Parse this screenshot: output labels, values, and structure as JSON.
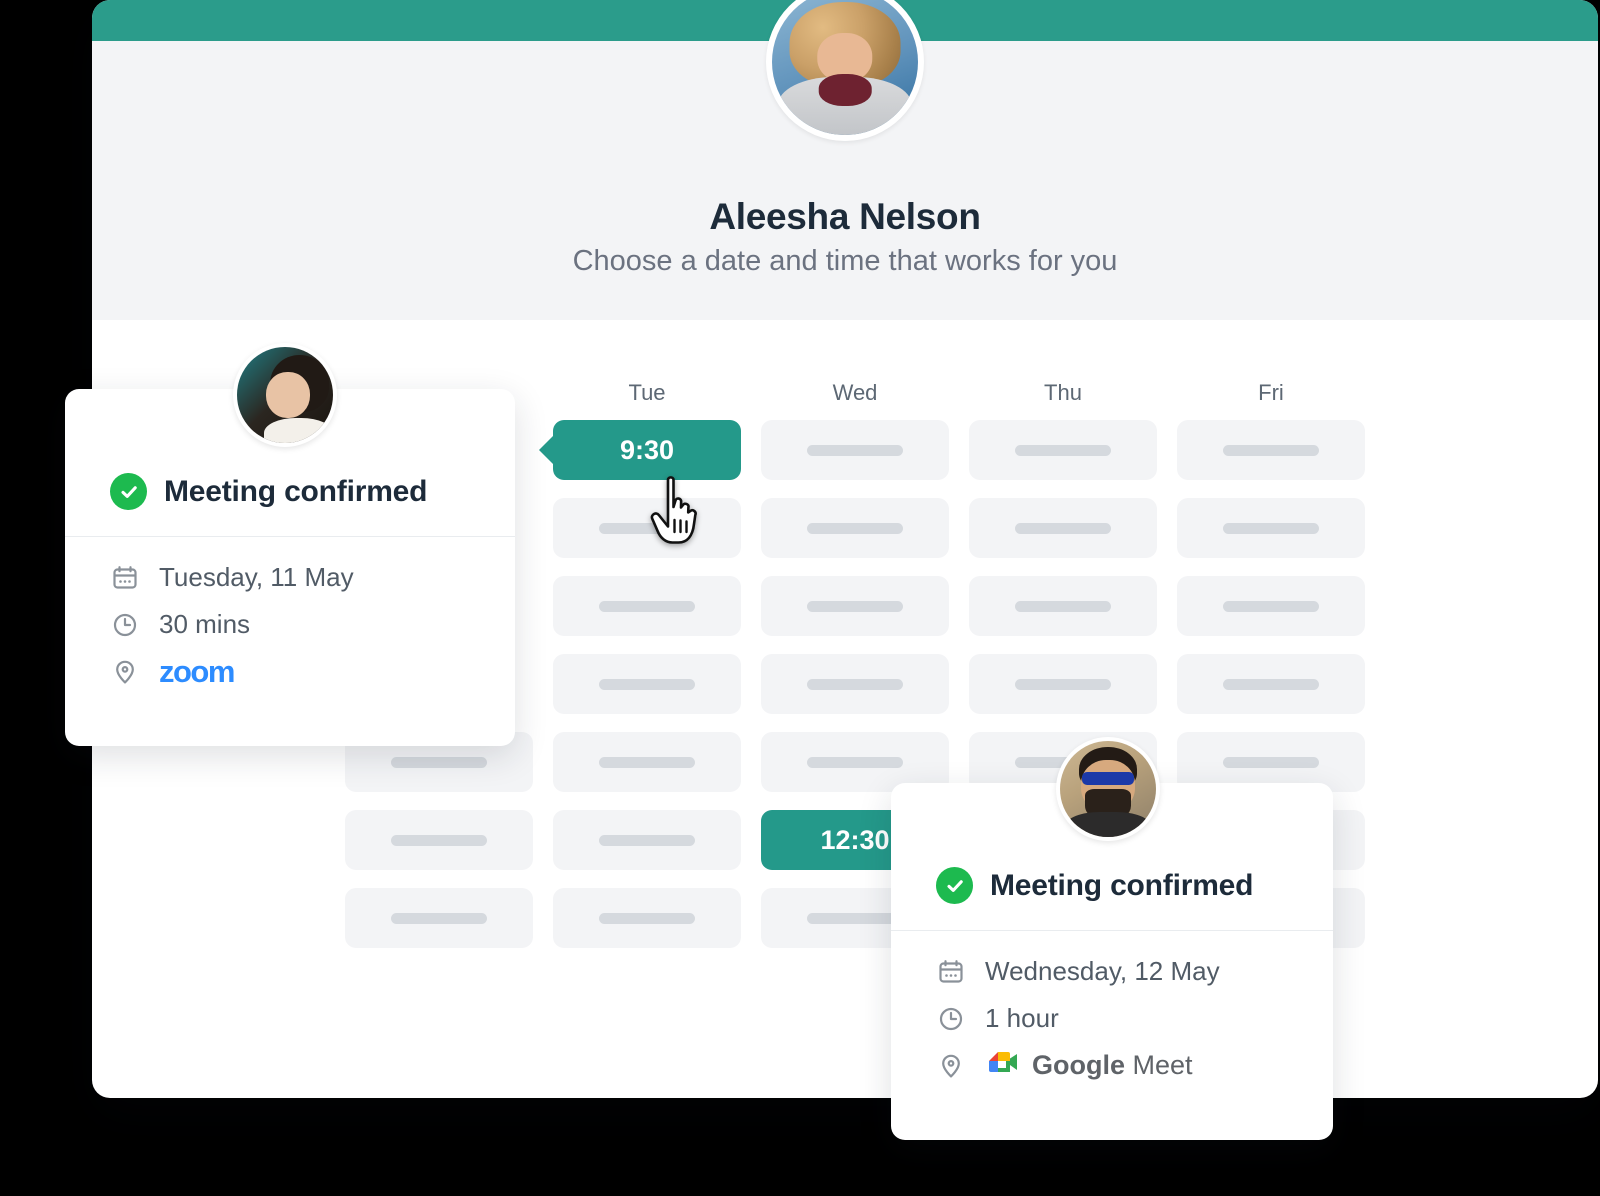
{
  "window": {
    "brand_color": "#2b9c8b",
    "header_bg": "#f3f4f6"
  },
  "header": {
    "avatar_name": "host-avatar",
    "host_name": "Aleesha Nelson",
    "subtitle": "Choose a date and time that works for you"
  },
  "calendar": {
    "day_headers": [
      "",
      "Tue",
      "Wed",
      "Thu",
      "Fri"
    ],
    "selected_color": "#24998a",
    "rows": [
      [
        {
          "state": "hidden",
          "label": ""
        },
        {
          "state": "selected",
          "label": "9:30",
          "notch": "left"
        },
        {
          "state": "empty",
          "label": ""
        },
        {
          "state": "empty",
          "label": ""
        },
        {
          "state": "empty",
          "label": ""
        }
      ],
      [
        {
          "state": "hidden",
          "label": ""
        },
        {
          "state": "empty",
          "label": ""
        },
        {
          "state": "empty",
          "label": ""
        },
        {
          "state": "empty",
          "label": ""
        },
        {
          "state": "empty",
          "label": ""
        }
      ],
      [
        {
          "state": "hidden",
          "label": ""
        },
        {
          "state": "empty",
          "label": ""
        },
        {
          "state": "empty",
          "label": ""
        },
        {
          "state": "empty",
          "label": ""
        },
        {
          "state": "empty",
          "label": ""
        }
      ],
      [
        {
          "state": "hidden",
          "label": ""
        },
        {
          "state": "empty",
          "label": ""
        },
        {
          "state": "empty",
          "label": ""
        },
        {
          "state": "empty",
          "label": ""
        },
        {
          "state": "empty",
          "label": ""
        }
      ],
      [
        {
          "state": "empty",
          "label": ""
        },
        {
          "state": "empty",
          "label": ""
        },
        {
          "state": "empty",
          "label": ""
        },
        {
          "state": "empty",
          "label": ""
        },
        {
          "state": "empty",
          "label": ""
        }
      ],
      [
        {
          "state": "empty",
          "label": ""
        },
        {
          "state": "empty",
          "label": ""
        },
        {
          "state": "selected",
          "label": "12:30",
          "notch": "right"
        },
        {
          "state": "empty",
          "label": ""
        },
        {
          "state": "empty",
          "label": ""
        }
      ],
      [
        {
          "state": "empty",
          "label": ""
        },
        {
          "state": "empty",
          "label": ""
        },
        {
          "state": "empty",
          "label": ""
        },
        {
          "state": "empty",
          "label": ""
        },
        {
          "state": "empty",
          "label": ""
        }
      ]
    ]
  },
  "cursor": {
    "type": "pointing-hand"
  },
  "card_left": {
    "avatar_name": "attendee-avatar-woman",
    "title": "Meeting confirmed",
    "date": "Tuesday, 11 May",
    "duration": "30 mins",
    "location": "zoom",
    "location_kind": "zoom",
    "check_color": "#1dba4f",
    "zoom_color": "#2d8cff"
  },
  "card_right": {
    "avatar_name": "attendee-avatar-man",
    "title": "Meeting confirmed",
    "date": "Wednesday, 12 May",
    "duration": "1 hour",
    "location_bold": "Google",
    "location_light": " Meet",
    "location_kind": "google-meet",
    "check_color": "#1dba4f"
  }
}
